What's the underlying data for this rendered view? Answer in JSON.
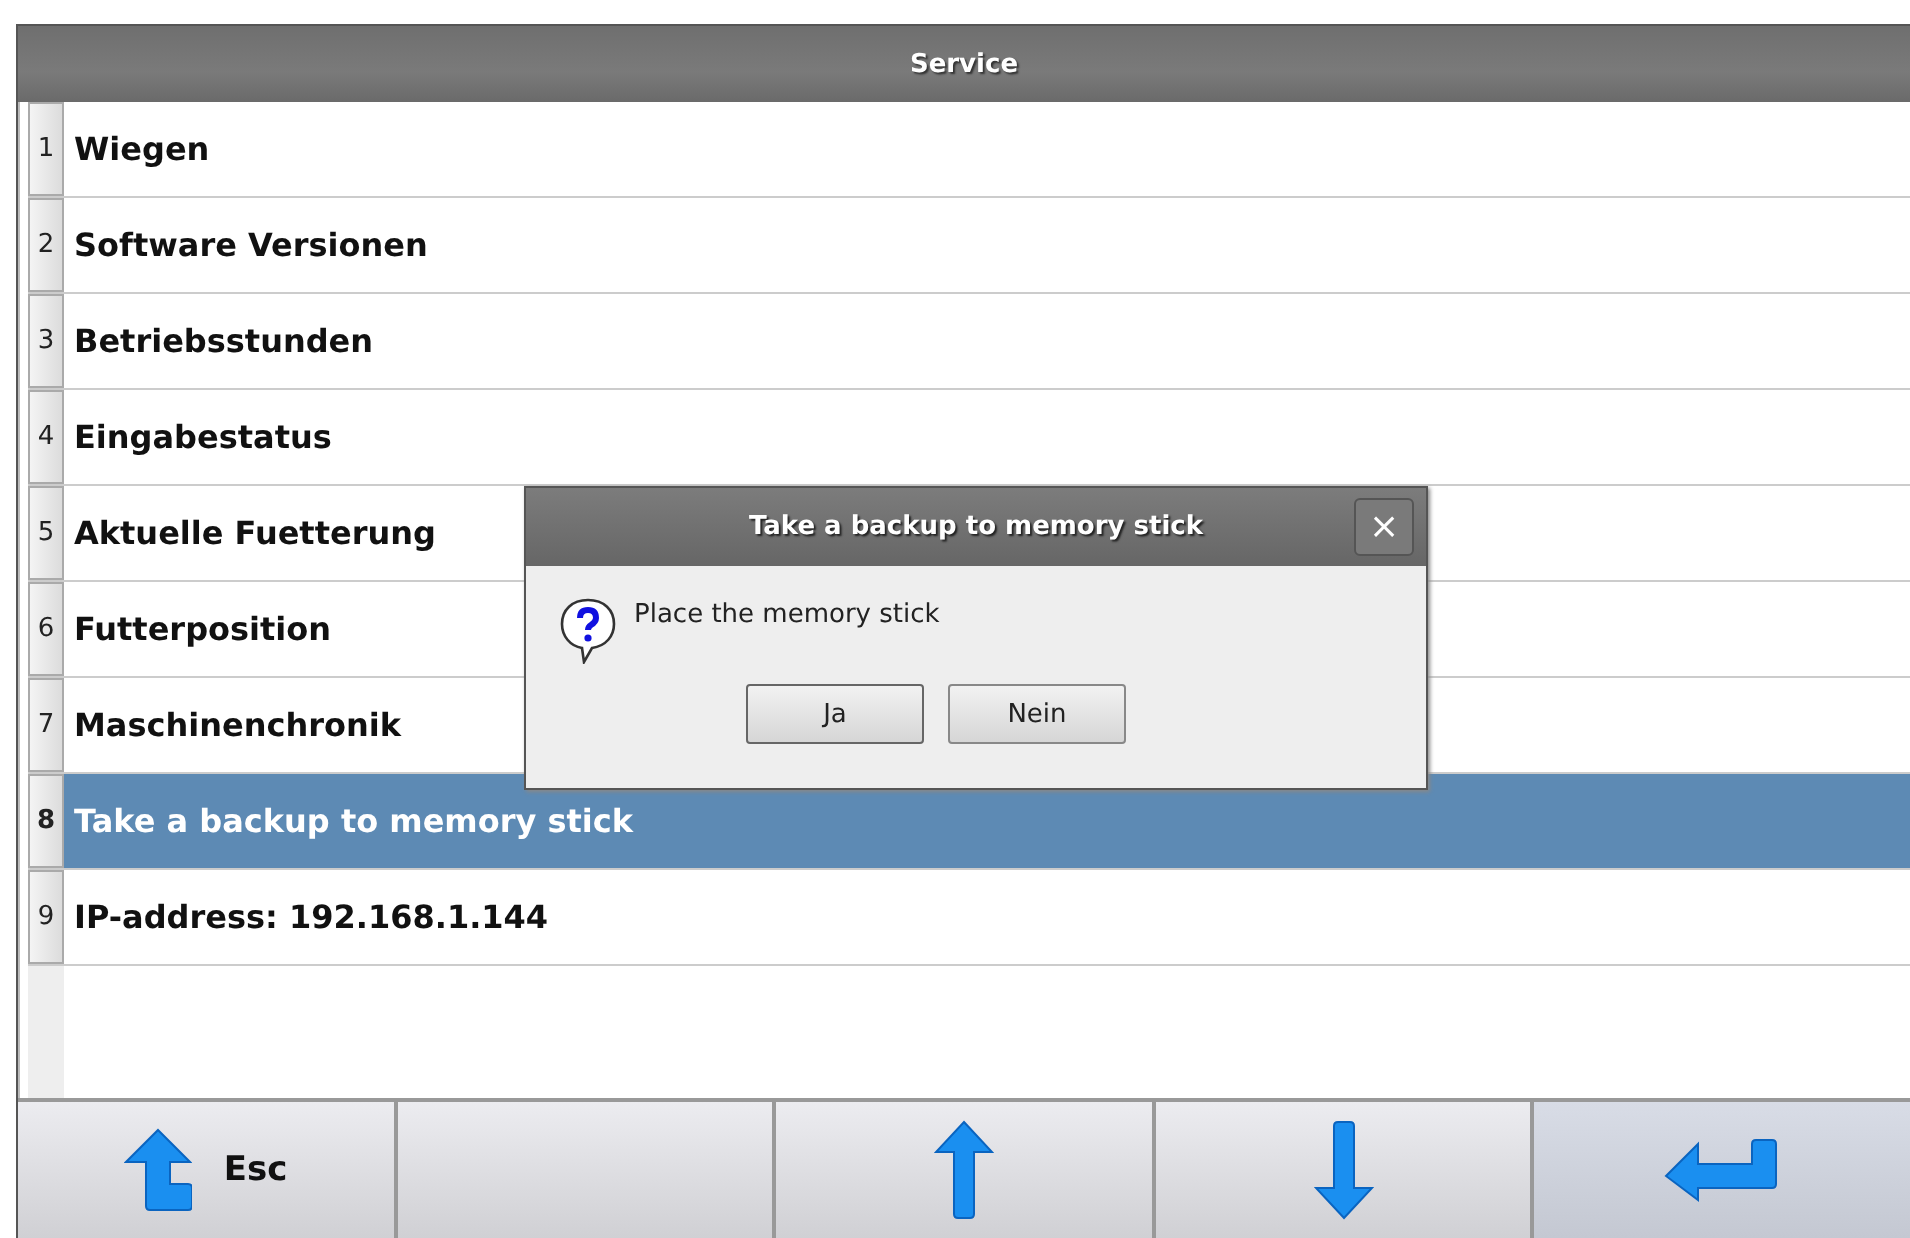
{
  "window": {
    "title": "Service"
  },
  "menu": {
    "items": [
      {
        "number": "1",
        "label": "Wiegen",
        "selected": false
      },
      {
        "number": "2",
        "label": "Software Versionen",
        "selected": false
      },
      {
        "number": "3",
        "label": "Betriebsstunden",
        "selected": false
      },
      {
        "number": "4",
        "label": "Eingabestatus",
        "selected": false
      },
      {
        "number": "5",
        "label": "Aktuelle Fuetterung",
        "selected": false
      },
      {
        "number": "6",
        "label": "Futterposition",
        "selected": false
      },
      {
        "number": "7",
        "label": "Maschinenchronik",
        "selected": false
      },
      {
        "number": "8",
        "label": "Take a backup to memory stick",
        "selected": true
      },
      {
        "number": "9",
        "label": "IP-address: 192.168.1.144",
        "selected": false
      }
    ]
  },
  "dialog": {
    "title": "Take a backup to memory stick",
    "close": "×",
    "message": "Place the memory stick",
    "buttons": [
      "Ja",
      "Nein"
    ]
  },
  "toolbar": [
    {
      "kind": "back",
      "label": "Esc"
    },
    {
      "kind": "empty"
    },
    {
      "kind": "up"
    },
    {
      "kind": "down"
    },
    {
      "kind": "enter"
    }
  ]
}
